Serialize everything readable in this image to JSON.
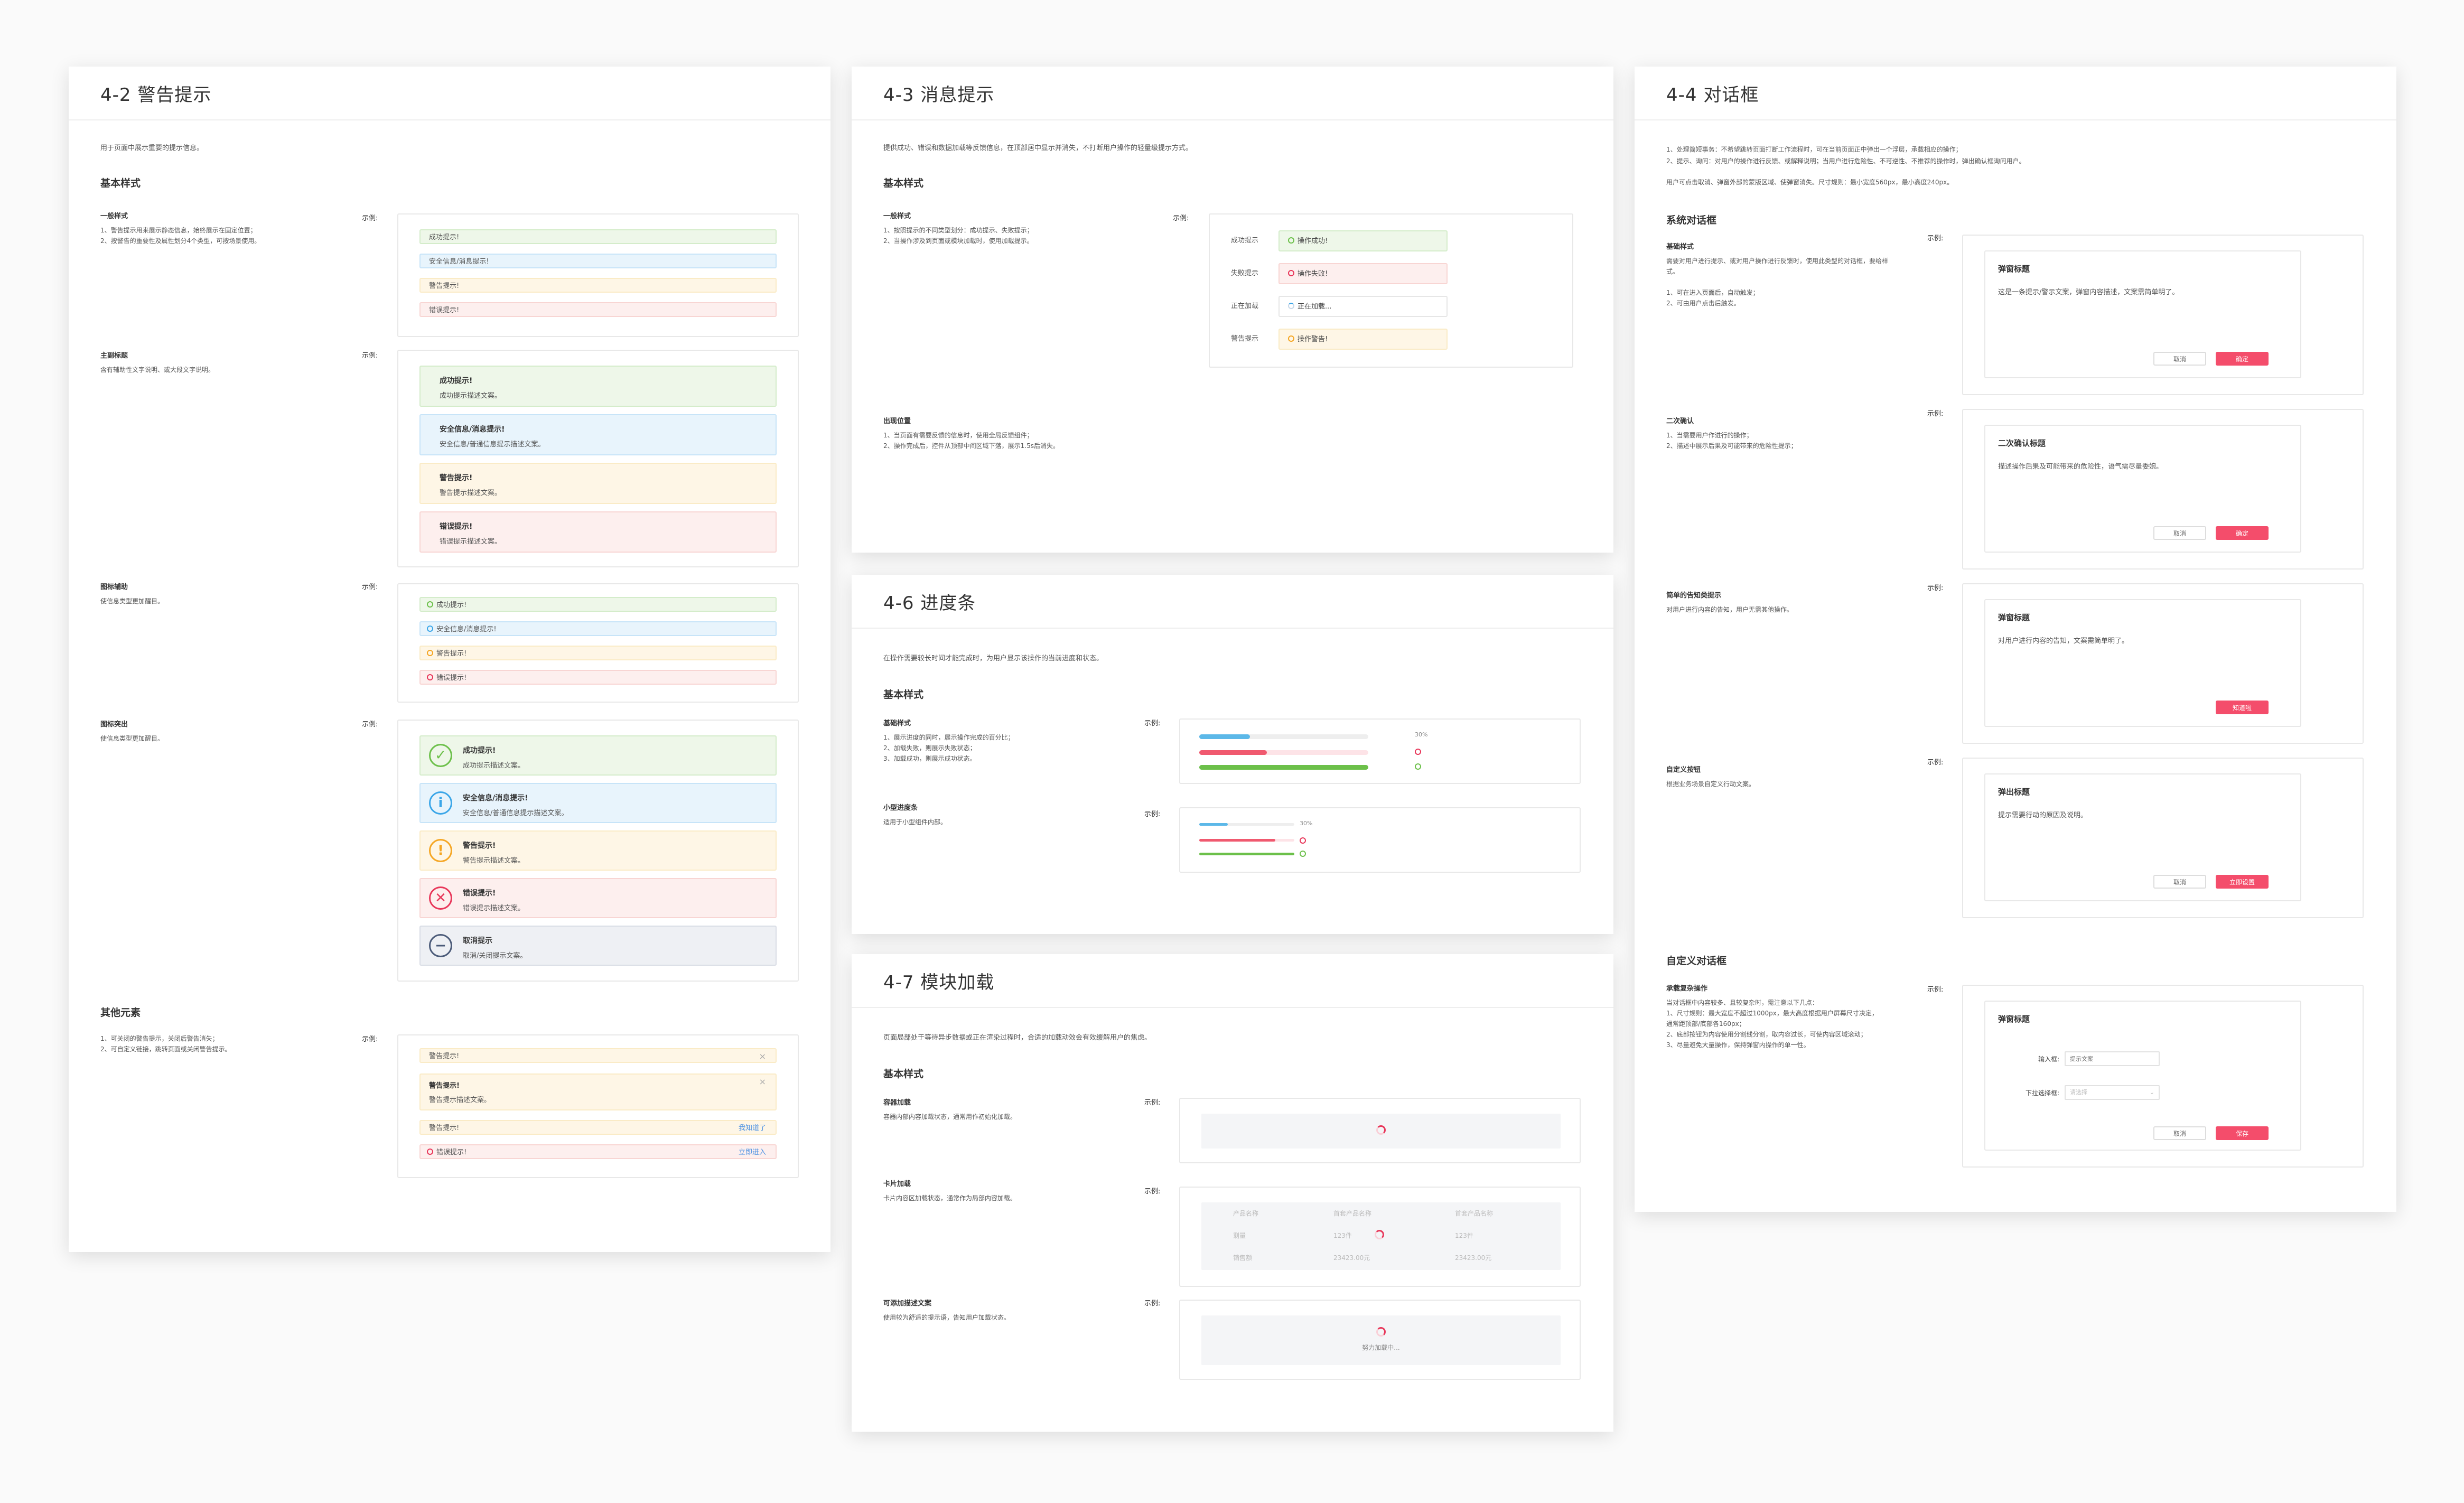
{
  "p42": {
    "title": "4-2 警告提示",
    "intro": "用于页面中展示重要的提示信息。",
    "basic": "基本样式",
    "other": "其他元素",
    "example": "示例:",
    "g1": {
      "label": "一般样式",
      "desc": "1、警告提示用来展示静态信息，始终展示在固定位置；\n2、按警告的重要性及属性划分4个类型，可按场景使用。",
      "items": [
        "成功提示!",
        "安全信息/消息提示!",
        "警告提示!",
        "错误提示!"
      ]
    },
    "g2": {
      "label": "主副标题",
      "desc": "含有辅助性文字说明、或大段文字说明。",
      "items": [
        {
          "t": "成功提示!",
          "d": "成功提示描述文案。"
        },
        {
          "t": "安全信息/消息提示!",
          "d": "安全信息/普通信息提示描述文案。"
        },
        {
          "t": "警告提示!",
          "d": "警告提示描述文案。"
        },
        {
          "t": "错误提示!",
          "d": "错误提示描述文案。"
        }
      ]
    },
    "g3": {
      "label": "图标辅助",
      "desc": "使信息类型更加醒目。",
      "items": [
        "成功提示!",
        "安全信息/消息提示!",
        "警告提示!",
        "错误提示!"
      ]
    },
    "g4": {
      "label": "图标突出",
      "desc": "使信息类型更加醒目。",
      "items": [
        {
          "t": "成功提示!",
          "d": "成功提示描述文案。"
        },
        {
          "t": "安全信息/消息提示!",
          "d": "安全信息/普通信息提示描述文案。"
        },
        {
          "t": "警告提示!",
          "d": "警告提示描述文案。"
        },
        {
          "t": "错误提示!",
          "d": "错误提示描述文案。"
        },
        {
          "t": "取消提示",
          "d": "取消/关闭提示文案。"
        }
      ]
    },
    "g5": {
      "label": "",
      "desc": "1、可关闭的警告提示，关闭后警告消失；\n2、可自定义链接，跳转页面或关闭警告提示。",
      "i1": "警告提示!",
      "i2t": "警告提示!",
      "i2d": "警告提示描述文案。",
      "i3": "警告提示!",
      "i3link": "我知道了",
      "i4": "错误提示!",
      "i4link": "立即进入",
      "close": "×"
    }
  },
  "p43": {
    "title": "4-3 消息提示",
    "intro": "提供成功、错误和数据加载等反馈信息，在顶部居中显示并消失，不打断用户操作的轻量级提示方式。",
    "basic": "基本样式",
    "example": "示例:",
    "g1": {
      "label": "一般样式",
      "desc": "1、按照提示的不同类型划分：成功提示、失败提示；\n2、当操作涉及到页面或模块加载时，使用加载提示。"
    },
    "msgs": [
      {
        "l": "成功提示",
        "t": "操作成功!"
      },
      {
        "l": "失败提示",
        "t": "操作失败!"
      },
      {
        "l": "正在加载",
        "t": "正在加载..."
      },
      {
        "l": "警告提示",
        "t": "操作警告!"
      }
    ],
    "pos": {
      "label": "出现位置",
      "desc": "1、当页面有需要反馈的信息时，使用全局反馈组件；\n2、操作完成后，控件从顶部中间区域下落，展示1.5s后消失。"
    }
  },
  "p44": {
    "title": "4-4 对话框",
    "intro1": "1、处理简短事务：不希望跳转页面打断工作流程时，可在当前页面正中弹出一个浮层，承载相应的操作；",
    "intro2": "2、提示、询问：对用户的操作进行反馈、或解释说明；当用户进行危险性、不可逆性、不推荐的操作时，弹出确认框询问用户。",
    "intro3": "用户可点击取消、弹窗外部的蒙版区域、使弹窗消失。尺寸规则：最小宽度560px，最小高度240px。",
    "sys": "系统对话框",
    "custom": "自定义对话框",
    "example": "示例:",
    "cancel": "取消",
    "confirm": "确定",
    "d1": {
      "label": "基础样式",
      "desc": "需要对用户进行提示、或对用户操作进行反馈时，使用此类型的对话框，要给样式。\n\n1、可在进入页面后，自动触发；\n2、可由用户点击后触发。",
      "title": "弹窗标题",
      "text": "这是一条提示/警示文案，弹窗内容描述，文案需简单明了。"
    },
    "d2": {
      "label": "二次确认",
      "desc": "1、当需要用户作进行的操作；\n2、描述中展示后果及可能带来的危险性提示；",
      "title": "二次确认标题",
      "text": "描述操作后果及可能带来的危险性，语气需尽量委婉。"
    },
    "d3": {
      "label": "简单的告知类提示",
      "desc": "对用户进行内容的告知，用户无需其他操作。",
      "title": "弹窗标题",
      "text": "对用户进行内容的告知，文案需简单明了。",
      "btn": "知道啦"
    },
    "d4": {
      "label": "自定义按钮",
      "desc": "根据业务场景自定义行动文案。",
      "title": "弹出标题",
      "text": "提示需要行动的原因及说明。",
      "btn": "立即设置"
    },
    "d5": {
      "label": "承载复杂操作",
      "desc": "当对话框中内容较多、且较复杂时，需注意以下几点：\n1、尺寸规则：最大宽度不超过1000px，最大高度根据用户屏幕尺寸决定，通常距顶部/底部各160px；\n2、底部按钮为内容使用分割线分割，取内容过长，可使内容区域滚动；\n3、尽量避免大量操作，保持弹窗内操作的单一性。",
      "title": "弹窗标题",
      "field1": "输入框:",
      "ph1": "提示文案",
      "field2": "下拉选择框:",
      "ph2": "请选择",
      "save": "保存"
    }
  },
  "p46": {
    "title": "4-6 进度条",
    "intro": "在操作需要较长时间才能完成时，为用户显示该操作的当前进度和状态。",
    "basic": "基本样式",
    "example": "示例:",
    "g1": {
      "label": "基础样式",
      "desc": "1、展示进度的同时，展示操作完成的百分比；\n2、加载失败，则展示失败状态；\n3、加载成功，则展示成功状态。",
      "pct": "30%",
      "progress": [
        0.3,
        0.4,
        1.0
      ]
    },
    "g2": {
      "label": "小型进度条",
      "desc": "适用于小型组件内部。",
      "pct": "30%",
      "progress": [
        0.3,
        0.8,
        1.0
      ]
    }
  },
  "p47": {
    "title": "4-7 模块加载",
    "intro": "页面局部处于等待异步数据或正在渲染过程时，合适的加载动效会有效缓解用户的焦虑。",
    "basic": "基本样式",
    "example": "示例:",
    "g1": {
      "label": "容器加载",
      "desc": "容器内部内容加载状态，通常用作初始化加载。"
    },
    "g2": {
      "label": "卡片加载",
      "desc": "卡片内容区加载状态，通常作为局部内容加载。",
      "rows": [
        [
          "产品名称",
          "首套产品名称",
          "首套产品名称"
        ],
        [
          "剩量",
          "123件",
          "123件"
        ],
        [
          "销售额",
          "23423.00元",
          "23423.00元"
        ]
      ]
    },
    "g3": {
      "label": "可添加描述文案",
      "desc": "使用较为舒适的提示语，告知用户加载状态。",
      "loading": "努力加载中..."
    }
  }
}
